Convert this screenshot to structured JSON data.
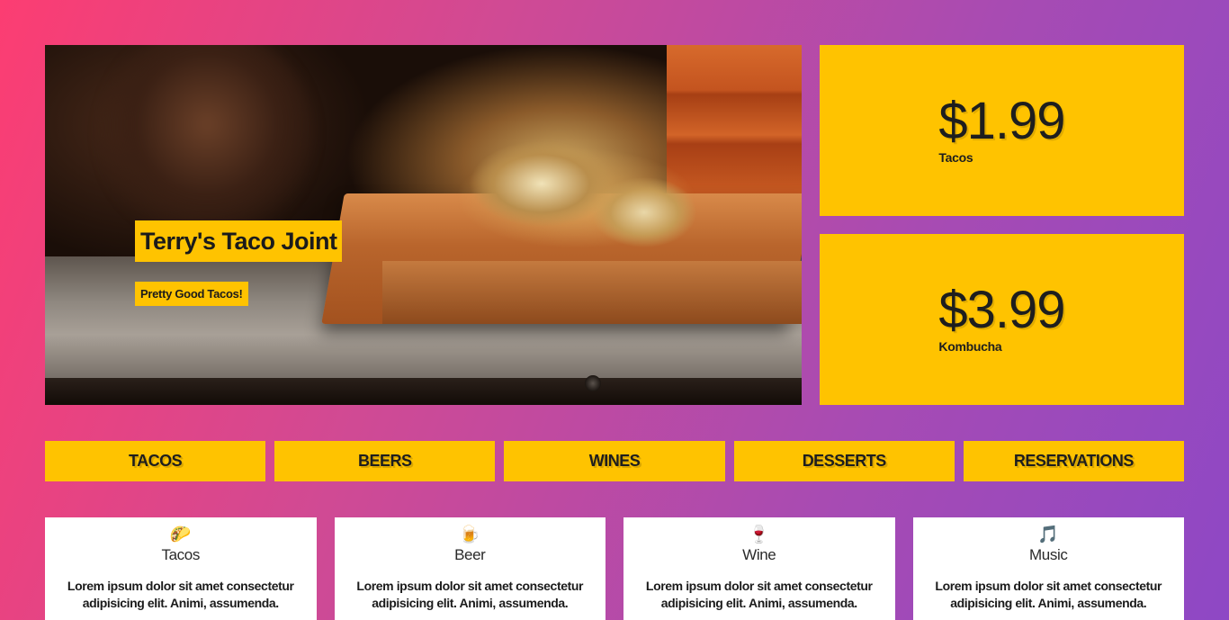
{
  "hero": {
    "title": "Terry's Taco Joint",
    "subtitle": "Pretty Good Tacos!"
  },
  "prices": [
    {
      "amount": "$1.99",
      "label": "Tacos"
    },
    {
      "amount": "$3.99",
      "label": "Kombucha"
    }
  ],
  "nav": [
    {
      "label": "TACOS"
    },
    {
      "label": "BEERS"
    },
    {
      "label": "WINES"
    },
    {
      "label": "DESSERTS"
    },
    {
      "label": "RESERVATIONS"
    }
  ],
  "features": [
    {
      "icon": "🌮",
      "icon_name": "taco-icon",
      "title": "Tacos",
      "text": "Lorem ipsum dolor sit amet consectetur adipisicing elit. Animi, assumenda."
    },
    {
      "icon": "🍺",
      "icon_name": "beer-icon",
      "title": "Beer",
      "text": "Lorem ipsum dolor sit amet consectetur adipisicing elit. Animi, assumenda."
    },
    {
      "icon": "🍷",
      "icon_name": "wine-glass-icon",
      "title": "Wine",
      "text": "Lorem ipsum dolor sit amet consectetur adipisicing elit. Animi, assumenda."
    },
    {
      "icon": "🎵",
      "icon_name": "music-note-icon",
      "title": "Music",
      "text": "Lorem ipsum dolor sit amet consectetur adipisicing elit. Animi, assumenda."
    }
  ],
  "colors": {
    "accent": "#ffc300",
    "gradient_start": "#fc3d72",
    "gradient_end": "#8e48c5"
  }
}
